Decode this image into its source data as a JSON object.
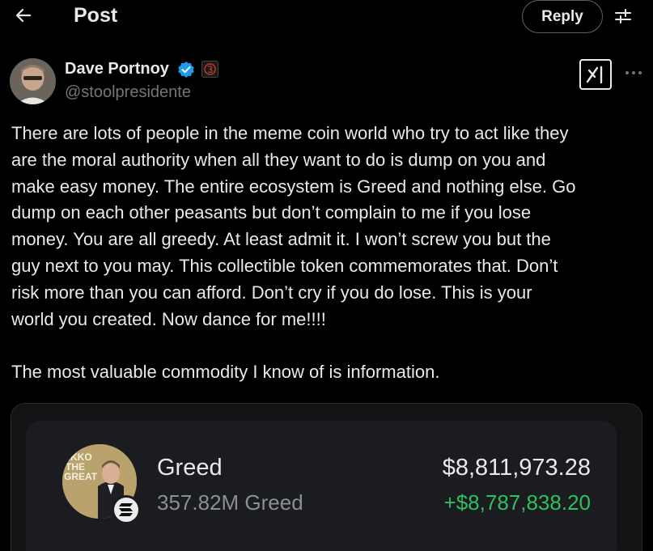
{
  "header": {
    "title": "Post",
    "reply_label": "Reply",
    "back_icon": "arrow-left-icon",
    "adjust_icon": "sliders-icon"
  },
  "author": {
    "name": "Dave Portnoy",
    "handle": "@stoolpresidente",
    "verified": true,
    "verified_color": "#1d9bf0"
  },
  "post": {
    "paragraphs": [
      [
        "There are lots of people in the meme coin world who try to act like they",
        "are the moral authority when all they want to do is dump on you and",
        "make easy money.  The entire ecosystem is Greed and nothing else.   Go",
        "dump on each other peasants but don’t complain to me if you lose",
        "money.  You are all greedy.   At least admit it.   I won’t screw you but the",
        "guy next to you may.   This collectible token commemorates that.   Don’t",
        "risk more than you can afford.   Don’t cry if you do lose.  This is your",
        "world you created.  Now dance for me!!!!"
      ],
      [
        "The most valuable commodity I know of is information."
      ]
    ]
  },
  "token_card": {
    "name": "Greed",
    "amount": "357.82M Greed",
    "value": "$8,811,973.28",
    "change": "+$8,787,838.20",
    "change_color": "#2fbf5f",
    "image_text": [
      "EKKO",
      "THE",
      "GREAT"
    ]
  }
}
